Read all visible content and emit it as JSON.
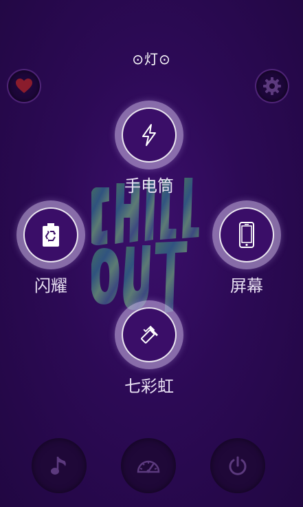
{
  "app": {
    "title": "⊙灯⊙"
  },
  "corner": {
    "favorite_icon": "heart-icon",
    "settings_icon": "gear-icon"
  },
  "modes": {
    "flashlight": {
      "label": "手电筒",
      "icon": "lightning-icon"
    },
    "flash": {
      "label": "闪耀",
      "icon": "recycle-battery-icon"
    },
    "screen": {
      "label": "屏幕",
      "icon": "phone-icon"
    },
    "rainbow": {
      "label": "七彩虹",
      "icon": "paint-roller-icon"
    }
  },
  "artwork": {
    "text": "CHILL OUT"
  },
  "bottom_bar": {
    "music_icon": "music-note-icon",
    "speed_icon": "speedometer-icon",
    "power_icon": "power-icon"
  },
  "colors": {
    "background": "#2c0a55",
    "button_ring": "#d2beeb",
    "button_fill": "#3a0e68",
    "heart": "#8a1c2c",
    "muted_icon": "#5c3a7e"
  }
}
